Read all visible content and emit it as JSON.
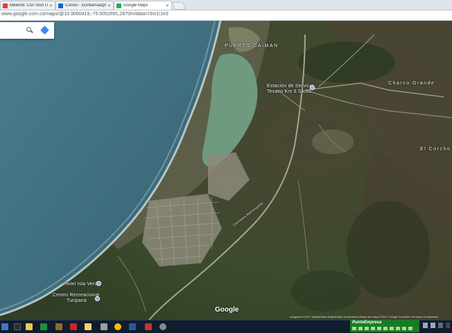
{
  "browser": {
    "tabs": [
      {
        "label": "Melendi: Con Sólo Ui...",
        "favicon_color": "#e53935",
        "active": false
      },
      {
        "label": "Correo - icuribarraa@lo...",
        "favicon_color": "#1565c0",
        "active": false
      },
      {
        "label": "Google Maps",
        "favicon_color": "#34a853",
        "active": true
      }
    ],
    "url": "www.google.com.co/maps/@10.9060419,-75.0052891,2870m/data=!3m1!1e3"
  },
  "map": {
    "labels": {
      "puerto_caiman": "PUERTO CAIMAN",
      "estacion": "Estación de Servicio",
      "texaco": "Texaco Km 6 Santa",
      "charco_grande": "Charco Grande",
      "el_corcho": "El Corcho",
      "road": "Carretera Barranquilla",
      "hotel": "Hotel Isla Verde",
      "centro1": "Centro Recreacional",
      "centro2": "Turipaná"
    },
    "logo": "Google",
    "attribution": "Imágenes ©2017 DigitalGlobe,DigitalGlobe,Terrametrics,Datos del mapa ©2017 Google   Colombia   Términos   Condiciones"
  },
  "taskbar": {
    "tray_title": "PuntoEmpresa"
  },
  "colors": {
    "sea": "#3e6f82",
    "land": "#3f4a2e",
    "lagoon": "#6f9a80",
    "surf": "#c9d9dc"
  }
}
